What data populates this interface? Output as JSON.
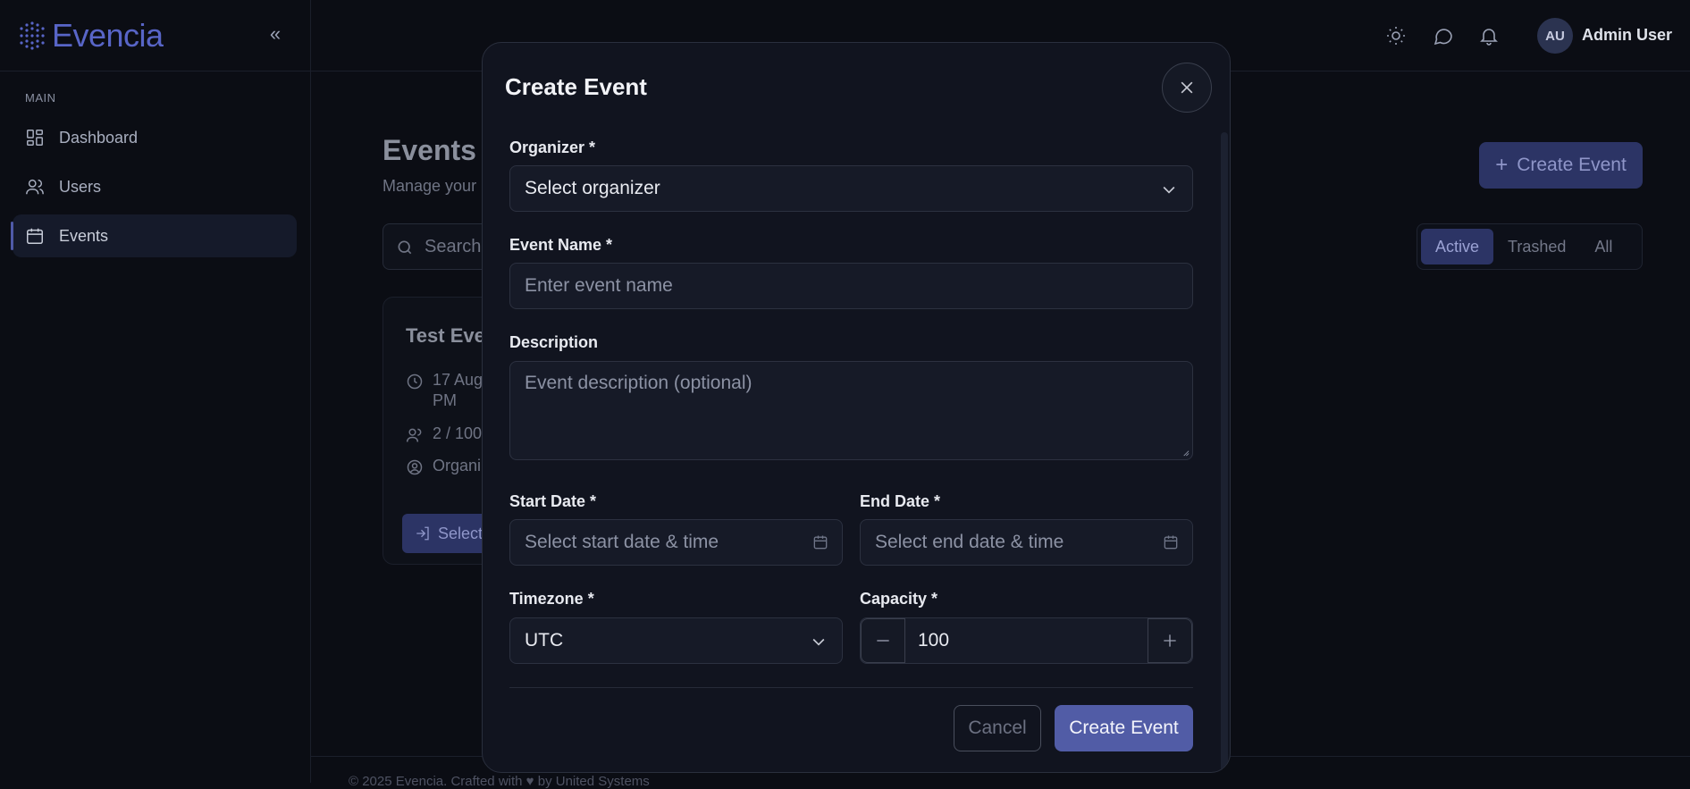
{
  "app": {
    "brand": "Evencia",
    "accent": "#5865c7"
  },
  "sidebar": {
    "section": "MAIN",
    "items": [
      {
        "label": "Dashboard",
        "icon": "dashboard-icon"
      },
      {
        "label": "Users",
        "icon": "users-icon"
      },
      {
        "label": "Events",
        "icon": "calendar-icon",
        "active": true
      }
    ]
  },
  "topbar": {
    "user_initials": "AU",
    "user_name": "Admin User",
    "icons": [
      "sun-icon",
      "chat-icon",
      "bell-icon"
    ]
  },
  "page": {
    "title": "Events",
    "subtitle": "Manage your",
    "search_placeholder": "Search",
    "create_label": "Create Event",
    "filters": [
      "Active",
      "Trashed",
      "All"
    ],
    "active_filter": "Active",
    "card": {
      "title": "Test Eve",
      "date_line1": "17 Aug",
      "date_line2": "PM",
      "capacity": "2 / 100",
      "organizer": "Organi",
      "button": "Select"
    },
    "footer": "© 2025 Evencia. Crafted with ♥ by United Systems"
  },
  "modal": {
    "title": "Create Event",
    "organizer": {
      "label": "Organizer *",
      "value": "Select organizer"
    },
    "event_name": {
      "label": "Event Name *",
      "placeholder": "Enter event name"
    },
    "description": {
      "label": "Description",
      "placeholder": "Event description (optional)"
    },
    "start_date": {
      "label": "Start Date *",
      "placeholder": "Select start date & time"
    },
    "end_date": {
      "label": "End Date *",
      "placeholder": "Select end date & time"
    },
    "timezone": {
      "label": "Timezone *",
      "value": "UTC"
    },
    "capacity": {
      "label": "Capacity *",
      "value": "100"
    },
    "cancel_label": "Cancel",
    "submit_label": "Create Event"
  }
}
